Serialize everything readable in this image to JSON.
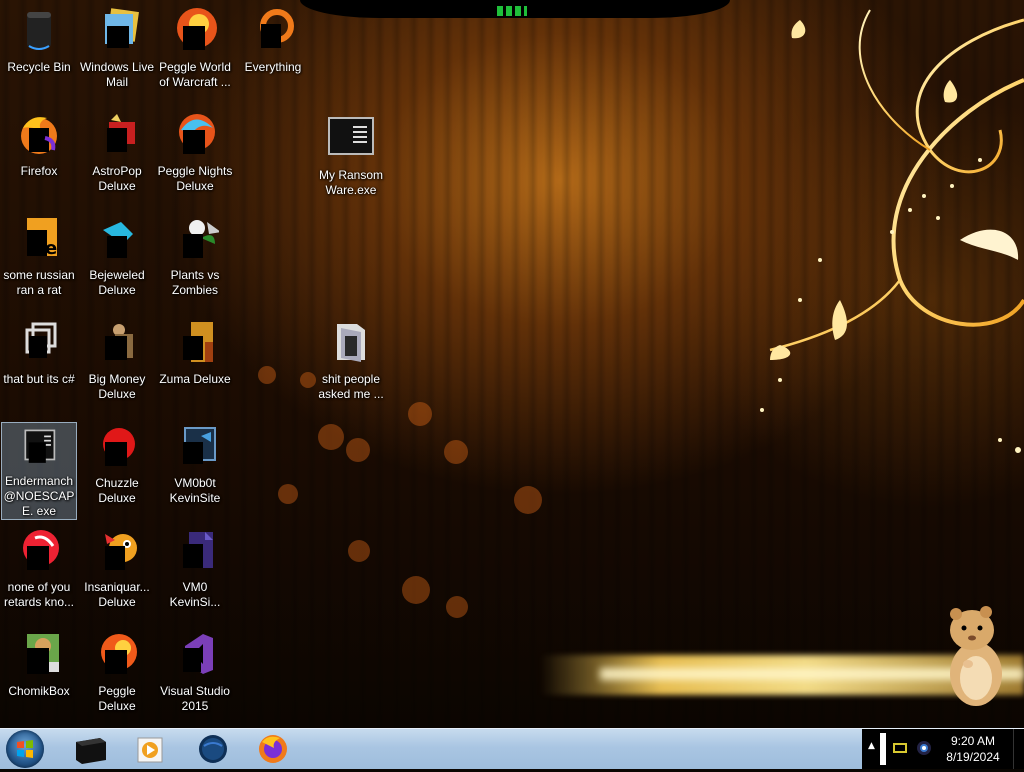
{
  "desktop": {
    "icons": [
      {
        "label": "Recycle Bin"
      },
      {
        "label": "Windows Live Mail"
      },
      {
        "label": "Peggle World of Warcraft ..."
      },
      {
        "label": "Everything"
      },
      {
        "label": "Firefox"
      },
      {
        "label": "AstroPop Deluxe"
      },
      {
        "label": "Peggle Nights Deluxe"
      },
      {
        "label": "My Ransom Ware.exe"
      },
      {
        "label": "some russian ran a rat"
      },
      {
        "label": "Bejeweled Deluxe"
      },
      {
        "label": "Plants vs Zombies"
      },
      {
        "label": "that but its c#"
      },
      {
        "label": "Big Money Deluxe"
      },
      {
        "label": "Zuma Deluxe"
      },
      {
        "label": "shit people asked me ..."
      },
      {
        "label": "Endermanch @NOESCAPE. exe"
      },
      {
        "label": "Chuzzle Deluxe"
      },
      {
        "label": "VM0b0t KevinSite"
      },
      {
        "label": "none of you retards kno..."
      },
      {
        "label": "Insaniquar... Deluxe"
      },
      {
        "label": "VM0 KevinSi..."
      },
      {
        "label": "ChomikBox"
      },
      {
        "label": "Peggle Deluxe"
      },
      {
        "label": "Visual Studio 2015"
      }
    ],
    "selected_icon": "Endermanch @NOESCAPE. exe"
  },
  "taskbar": {
    "pinned": [
      {
        "icon": "terminal-box-icon"
      },
      {
        "icon": "media-player-icon"
      },
      {
        "icon": "globe-icon"
      },
      {
        "icon": "firefox-icon"
      }
    ],
    "tray": {
      "show_hidden": "▲"
    },
    "clock": {
      "time": "9:20 AM",
      "date": "8/19/2024"
    }
  },
  "colors": {
    "taskbar": "#a9c5e2",
    "selection": "#96b9d7",
    "label_text": "#ffffff"
  }
}
